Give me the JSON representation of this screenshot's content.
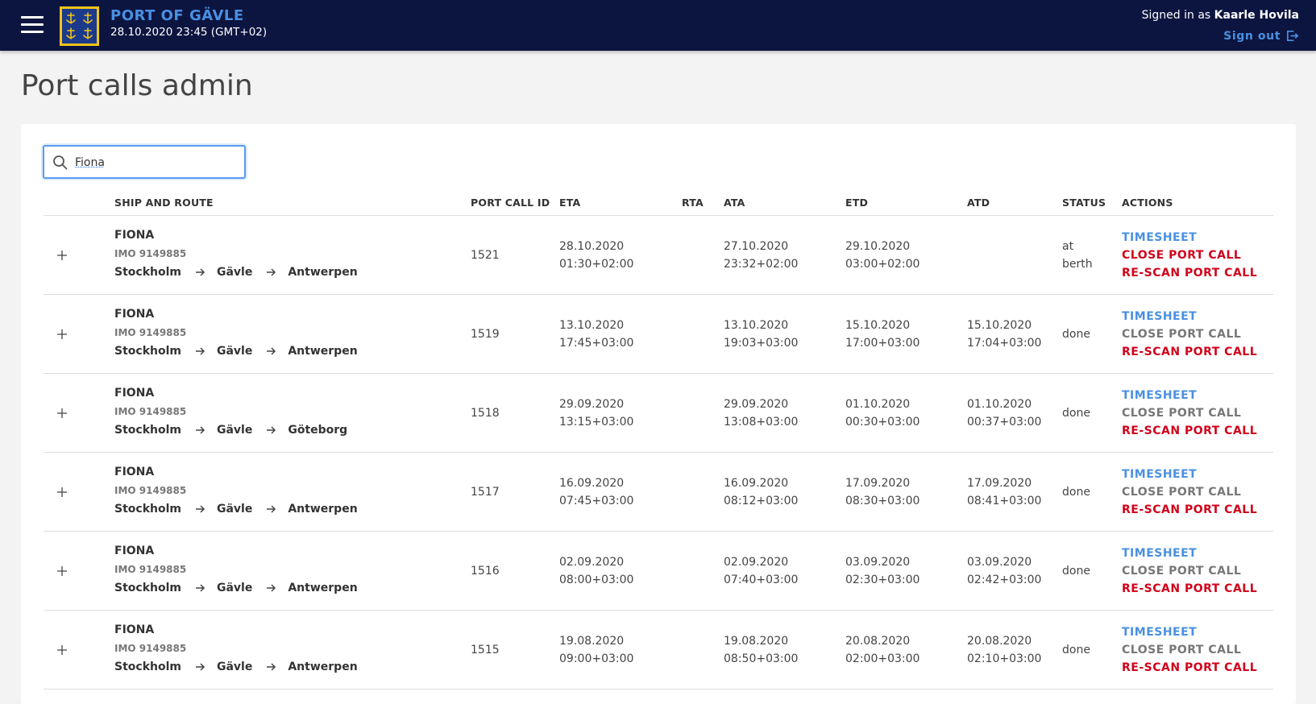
{
  "header": {
    "port_name": "PORT OF GÄVLE",
    "datetime": "28.10.2020 23:45 (GMT+02)",
    "signed_in_prefix": "Signed in as",
    "user_name": "Kaarle Hovila",
    "sign_out_label": "Sign out"
  },
  "page_title": "Port calls admin",
  "search": {
    "value": "Fiona"
  },
  "columns": {
    "ship_and_route": "SHIP AND ROUTE",
    "port_call_id": "PORT CALL ID",
    "eta": "ETA",
    "rta": "RTA",
    "ata": "ATA",
    "etd": "ETD",
    "atd": "ATD",
    "status": "STATUS",
    "actions": "ACTIONS"
  },
  "colors": {
    "header_bg": "#0c1540",
    "accent_blue": "#4a90e2",
    "action_red": "#d0021b",
    "action_gray": "#777777"
  },
  "rows": [
    {
      "ship": "FIONA",
      "imo": "IMO 9149885",
      "route": [
        "Stockholm",
        "Gävle",
        "Antwerpen"
      ],
      "id": "1521",
      "eta": [
        "28.10.2020",
        "01:30+02:00"
      ],
      "rta": [
        "",
        ""
      ],
      "ata": [
        "27.10.2020",
        "23:32+02:00"
      ],
      "etd": [
        "29.10.2020",
        "03:00+02:00"
      ],
      "atd": [
        "",
        ""
      ],
      "status": [
        "at",
        "berth"
      ],
      "actions": [
        "TIMESHEET",
        "CLOSE PORT CALL",
        "RE-SCAN PORT CALL"
      ],
      "close_enabled": true
    },
    {
      "ship": "FIONA",
      "imo": "IMO 9149885",
      "route": [
        "Stockholm",
        "Gävle",
        "Antwerpen"
      ],
      "id": "1519",
      "eta": [
        "13.10.2020",
        "17:45+03:00"
      ],
      "rta": [
        "",
        ""
      ],
      "ata": [
        "13.10.2020",
        "19:03+03:00"
      ],
      "etd": [
        "15.10.2020",
        "17:00+03:00"
      ],
      "atd": [
        "15.10.2020",
        "17:04+03:00"
      ],
      "status": [
        "done",
        ""
      ],
      "actions": [
        "TIMESHEET",
        "CLOSE PORT CALL",
        "RE-SCAN PORT CALL"
      ],
      "close_enabled": false
    },
    {
      "ship": "FIONA",
      "imo": "IMO 9149885",
      "route": [
        "Stockholm",
        "Gävle",
        "Göteborg"
      ],
      "id": "1518",
      "eta": [
        "29.09.2020",
        "13:15+03:00"
      ],
      "rta": [
        "",
        ""
      ],
      "ata": [
        "29.09.2020",
        "13:08+03:00"
      ],
      "etd": [
        "01.10.2020",
        "00:30+03:00"
      ],
      "atd": [
        "01.10.2020",
        "00:37+03:00"
      ],
      "status": [
        "done",
        ""
      ],
      "actions": [
        "TIMESHEET",
        "CLOSE PORT CALL",
        "RE-SCAN PORT CALL"
      ],
      "close_enabled": false
    },
    {
      "ship": "FIONA",
      "imo": "IMO 9149885",
      "route": [
        "Stockholm",
        "Gävle",
        "Antwerpen"
      ],
      "id": "1517",
      "eta": [
        "16.09.2020",
        "07:45+03:00"
      ],
      "rta": [
        "",
        ""
      ],
      "ata": [
        "16.09.2020",
        "08:12+03:00"
      ],
      "etd": [
        "17.09.2020",
        "08:30+03:00"
      ],
      "atd": [
        "17.09.2020",
        "08:41+03:00"
      ],
      "status": [
        "done",
        ""
      ],
      "actions": [
        "TIMESHEET",
        "CLOSE PORT CALL",
        "RE-SCAN PORT CALL"
      ],
      "close_enabled": false
    },
    {
      "ship": "FIONA",
      "imo": "IMO 9149885",
      "route": [
        "Stockholm",
        "Gävle",
        "Antwerpen"
      ],
      "id": "1516",
      "eta": [
        "02.09.2020",
        "08:00+03:00"
      ],
      "rta": [
        "",
        ""
      ],
      "ata": [
        "02.09.2020",
        "07:40+03:00"
      ],
      "etd": [
        "03.09.2020",
        "02:30+03:00"
      ],
      "atd": [
        "03.09.2020",
        "02:42+03:00"
      ],
      "status": [
        "done",
        ""
      ],
      "actions": [
        "TIMESHEET",
        "CLOSE PORT CALL",
        "RE-SCAN PORT CALL"
      ],
      "close_enabled": false
    },
    {
      "ship": "FIONA",
      "imo": "IMO 9149885",
      "route": [
        "Stockholm",
        "Gävle",
        "Antwerpen"
      ],
      "id": "1515",
      "eta": [
        "19.08.2020",
        "09:00+03:00"
      ],
      "rta": [
        "",
        ""
      ],
      "ata": [
        "19.08.2020",
        "08:50+03:00"
      ],
      "etd": [
        "20.08.2020",
        "02:00+03:00"
      ],
      "atd": [
        "20.08.2020",
        "02:10+03:00"
      ],
      "status": [
        "done",
        ""
      ],
      "actions": [
        "TIMESHEET",
        "CLOSE PORT CALL",
        "RE-SCAN PORT CALL"
      ],
      "close_enabled": false
    }
  ]
}
